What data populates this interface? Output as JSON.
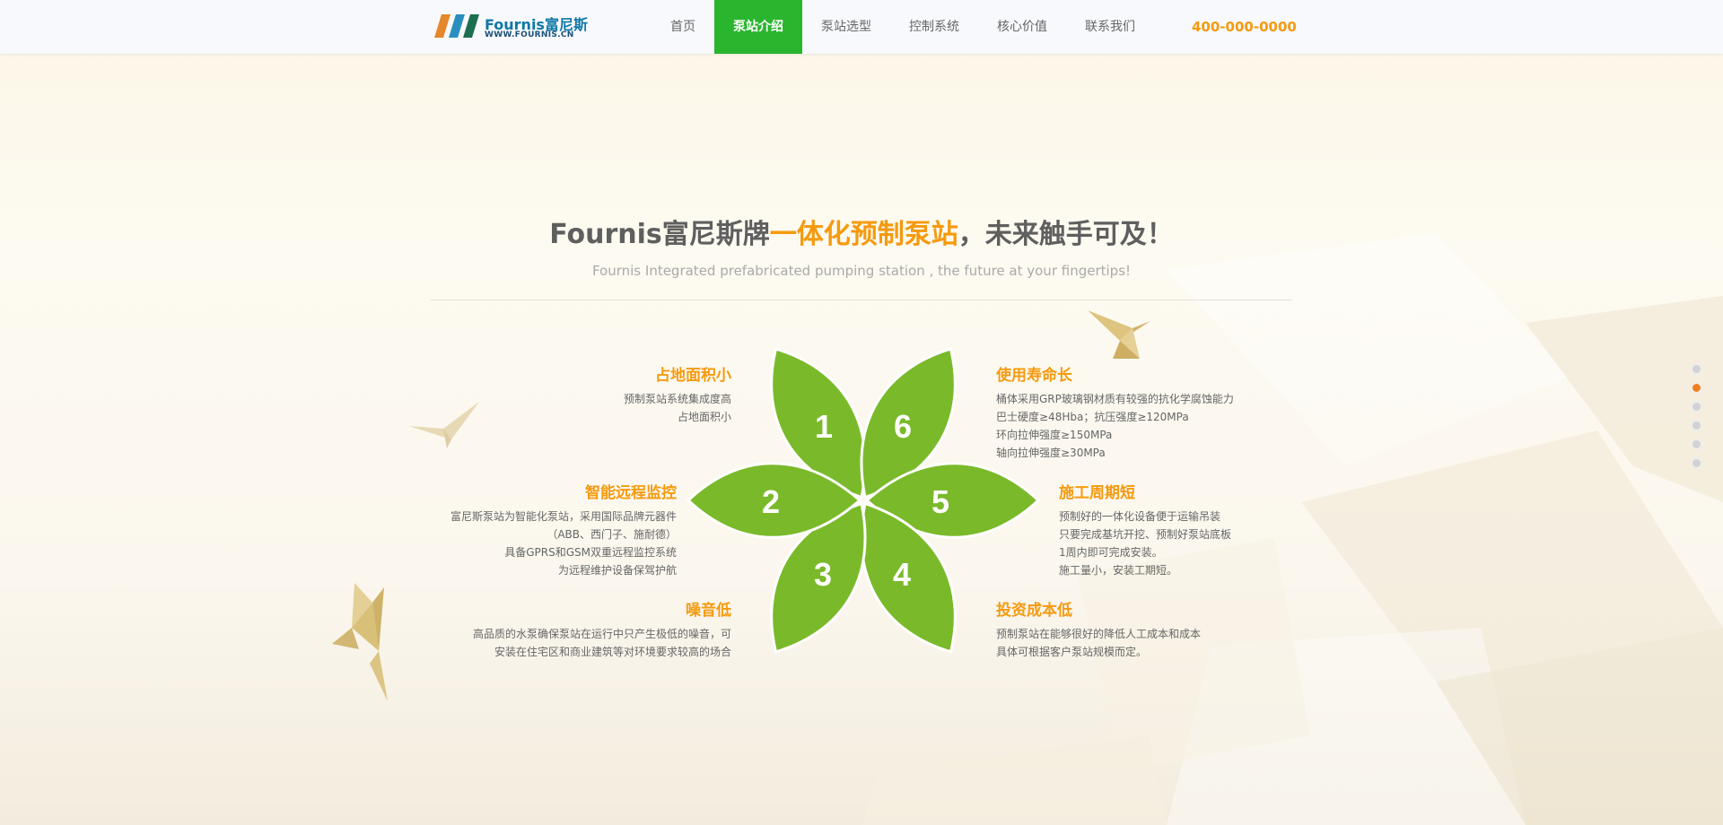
{
  "header": {
    "logo": {
      "name": "Fournis富尼斯",
      "url": "WWW.FOURNIS.CN"
    },
    "nav": [
      {
        "label": "首页",
        "active": false
      },
      {
        "label": "泵站介绍",
        "active": true
      },
      {
        "label": "泵站选型",
        "active": false
      },
      {
        "label": "控制系统",
        "active": false
      },
      {
        "label": "核心价值",
        "active": false
      },
      {
        "label": "联系我们",
        "active": false
      }
    ],
    "phone": "400-000-0000"
  },
  "hero": {
    "title_prefix": "Fournis富尼斯牌",
    "title_accent": "一体化预制泵站",
    "title_suffix": "，未来触手可及！",
    "subtitle": "Fournis Integrated prefabricated pumping station , the future at your fingertips!"
  },
  "flower": {
    "petals": [
      "1",
      "2",
      "3",
      "4",
      "5",
      "6"
    ]
  },
  "features": {
    "f1": {
      "title": "占地面积小",
      "lines": [
        "预制泵站系统集成度高",
        "占地面积小"
      ]
    },
    "f2": {
      "title": "智能远程监控",
      "lines": [
        "富尼斯泵站为智能化泵站，采用国际品牌元器件",
        "（ABB、西门子、施耐德）",
        "具备GPRS和GSM双重远程监控系统",
        "为远程维护设备保驾护航"
      ]
    },
    "f3": {
      "title": "噪音低",
      "lines": [
        "高品质的水泵确保泵站在运行中只产生极低的噪音，可",
        "安装在住宅区和商业建筑等对环境要求较高的场合"
      ]
    },
    "f6": {
      "title": "使用寿命长",
      "lines": [
        "桶体采用GRP玻璃钢材质有较强的抗化学腐蚀能力",
        "巴士硬度≥48Hba；抗压强度≥120MPa",
        "环向拉伸强度≥150MPa",
        "轴向拉伸强度≥30MPa"
      ]
    },
    "f5": {
      "title": "施工周期短",
      "lines": [
        "预制好的一体化设备便于运输吊装",
        "只要完成基坑开挖、预制好泵站底板",
        "1周内即可完成安装。",
        "施工量小，安装工期短。"
      ]
    },
    "f4": {
      "title": "投资成本低",
      "lines": [
        "预制泵站在能够很好的降低人工成本和成本",
        "具体可根据客户泵站规模而定。"
      ]
    }
  },
  "colors": {
    "accent_orange": "#f59a0f",
    "nav_active": "#2ab52e",
    "petal_green": "#7aba2a",
    "logo_blue": "#0f77a6"
  },
  "side_nav": {
    "count": 6,
    "active_index": 1
  }
}
